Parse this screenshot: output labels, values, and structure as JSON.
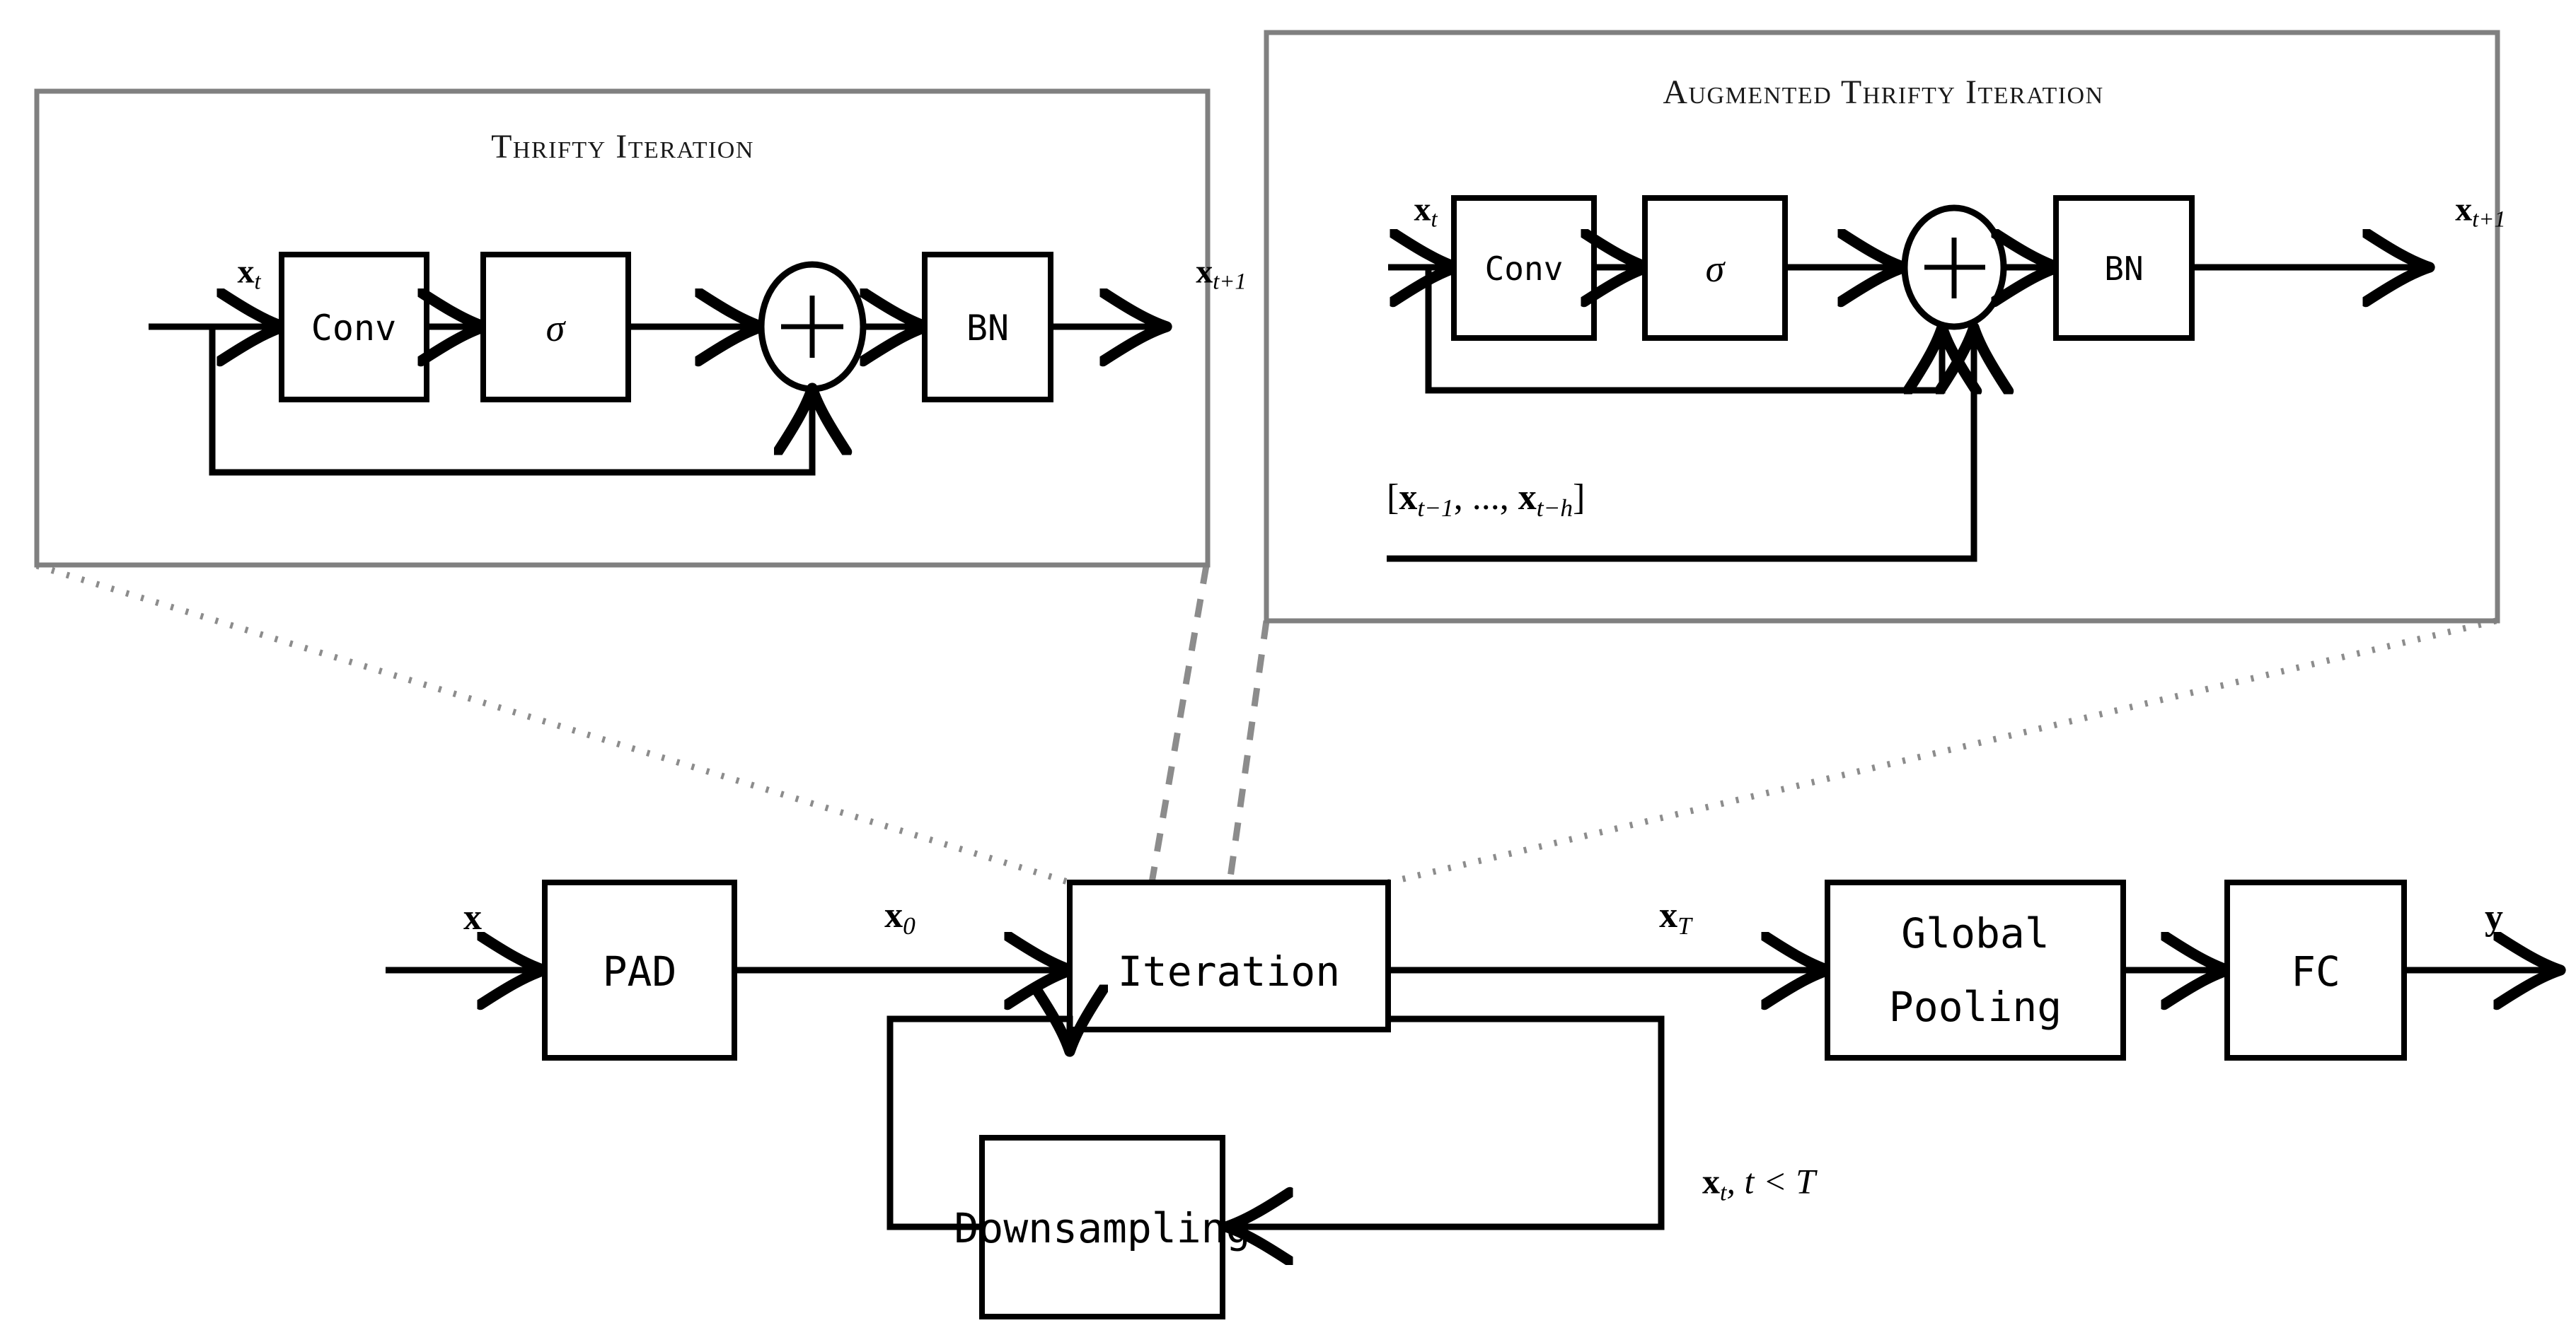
{
  "figure": {
    "kind": "neural-network-architecture-block-diagram",
    "background": "#ffffff",
    "panel_border_color": "#808080",
    "connector_color": "#8c8c8c",
    "line_color": "#000000"
  },
  "panels": {
    "thrifty": {
      "title": "Thrifty Iteration",
      "input_label_x": "x",
      "input_label_sub": "t",
      "output_label_x": "x",
      "output_label_sub": "t+1",
      "blocks": [
        {
          "id": "conv",
          "label": "Conv"
        },
        {
          "id": "sigma",
          "label": "σ"
        },
        {
          "id": "add",
          "label": "+"
        },
        {
          "id": "bn",
          "label": "BN"
        }
      ]
    },
    "augmented": {
      "title": "Augmented Thrifty Iteration",
      "input_label_x": "x",
      "input_label_sub": "t",
      "output_label_x": "x",
      "output_label_sub": "t+1",
      "history_open": "[",
      "history_x1": "x",
      "history_sub1": "t−1",
      "history_sep": ", ..., ",
      "history_x2": "x",
      "history_sub2": "t−h",
      "history_close": "]",
      "blocks": [
        {
          "id": "conv",
          "label": "Conv"
        },
        {
          "id": "sigma",
          "label": "σ"
        },
        {
          "id": "add",
          "label": "+"
        },
        {
          "id": "bn",
          "label": "BN"
        }
      ]
    }
  },
  "main_flow": {
    "blocks": [
      {
        "id": "pad",
        "label": "PAD"
      },
      {
        "id": "iteration",
        "label": "Iteration"
      },
      {
        "id": "global_pooling",
        "label_line1": "Global",
        "label_line2": "Pooling"
      },
      {
        "id": "fc",
        "label": "FC"
      },
      {
        "id": "downsampling",
        "label": "Downsampling"
      }
    ],
    "edge_labels": {
      "input": "x",
      "after_pad_x": "x",
      "after_pad_sub": "0",
      "after_iteration_x": "x",
      "after_iteration_sub": "T",
      "output": "y",
      "feedback_x": "x",
      "feedback_sub": "t",
      "feedback_cond": ", t < T"
    }
  }
}
